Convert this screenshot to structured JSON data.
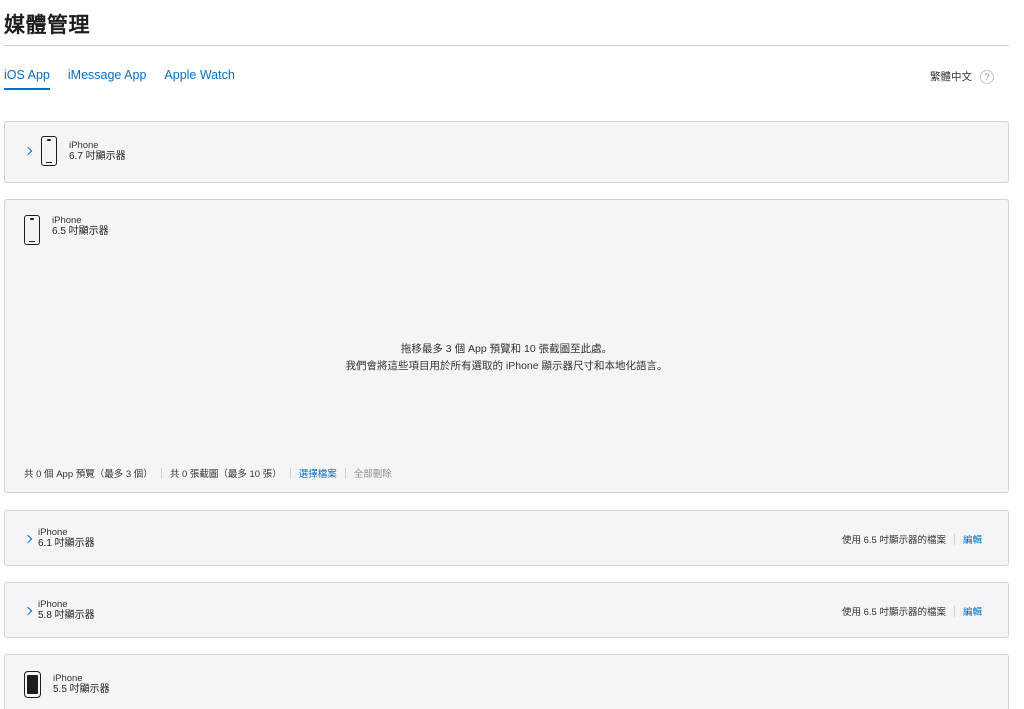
{
  "page": {
    "title": "媒體管理"
  },
  "tabs": [
    {
      "label": "iOS App",
      "active": true
    },
    {
      "label": "iMessage App",
      "active": false
    },
    {
      "label": "Apple Watch",
      "active": false
    }
  ],
  "language": {
    "label": "繁體中文",
    "help": "?"
  },
  "devices": {
    "d67": {
      "name": "iPhone",
      "size": "6.7 吋顯示器"
    },
    "d65": {
      "name": "iPhone",
      "size": "6.5 吋顯示器",
      "drop_line1": "拖移最多 3 個 App 預覽和 10 張截圖至此處。",
      "drop_line2": "我們會將這些項目用於所有選取的 iPhone 顯示器尺寸和本地化語言。",
      "preview_count": "共 0 個 App 預覽（最多 3 個）",
      "screenshot_count": "共 0 張截圖（最多 10 張）",
      "choose_file": "選擇檔案",
      "delete_all": "全部刪除"
    },
    "d61": {
      "name": "iPhone",
      "size": "6.1 吋顯示器",
      "using": "使用 6.5 吋顯示器的檔案",
      "edit": "編輯"
    },
    "d58": {
      "name": "iPhone",
      "size": "5.8 吋顯示器",
      "using": "使用 6.5 吋顯示器的檔案",
      "edit": "編輯"
    },
    "d55": {
      "name": "iPhone",
      "size": "5.5 吋顯示器"
    }
  },
  "colors": {
    "accent": "#0070c9",
    "panel_bg": "#f5f5f7",
    "border": "#d2d2d7"
  }
}
